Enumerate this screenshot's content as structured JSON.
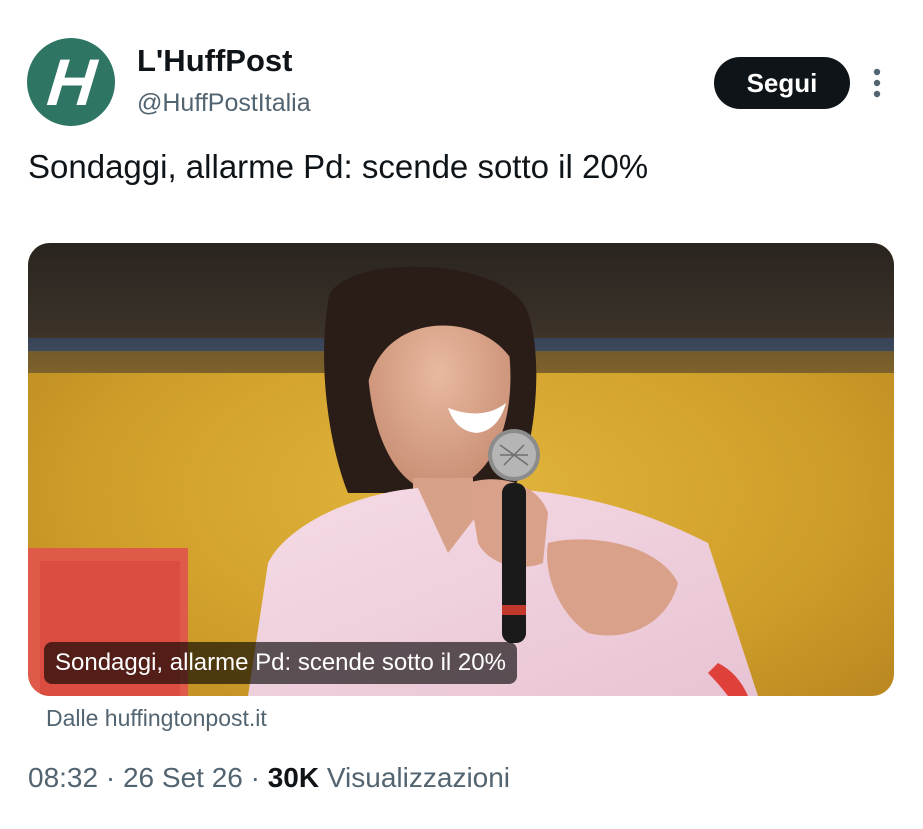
{
  "author": {
    "avatar_letter": "H",
    "avatar_color": "#2e7564",
    "display_name": "L'HuffPost",
    "handle": "@HuffPostItalia"
  },
  "follow_button": {
    "label": "Segui"
  },
  "more_menu": {
    "icon": "more-vertical-icon"
  },
  "tweet": {
    "text": "Sondaggi, allarme Pd: scende sotto il 20%"
  },
  "link_card": {
    "image_alt": "photo-woman-smiling-with-microphone",
    "title": "Sondaggi, allarme Pd: scende sotto il 20%",
    "source": "Dalle huffingtonpost.it"
  },
  "meta": {
    "time": "08:32",
    "separator": "·",
    "date": "26 Set 26",
    "separator2": "·",
    "views_count": "30K",
    "views_label": "Visualizzazioni"
  },
  "colors": {
    "text_primary": "#0f1419",
    "text_secondary": "#536471",
    "button_bg": "#0f1419"
  }
}
